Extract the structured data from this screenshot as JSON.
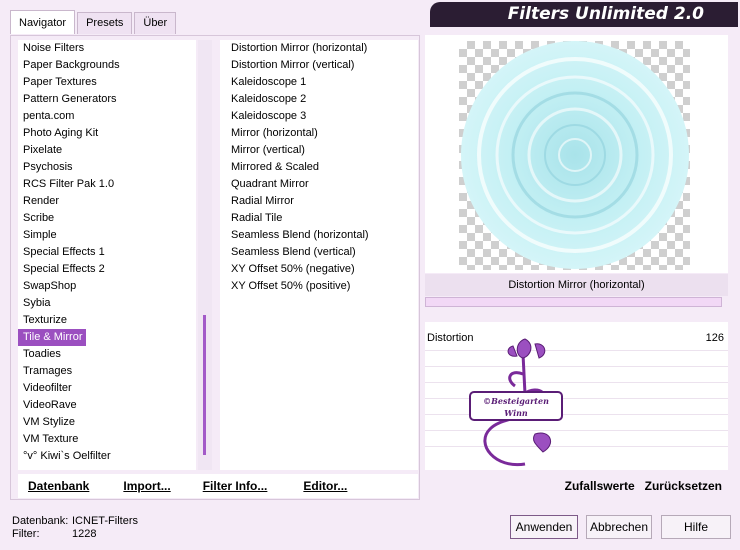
{
  "header": {
    "title": "Filters Unlimited 2.0"
  },
  "tabs": [
    {
      "label": "Navigator"
    },
    {
      "label": "Presets"
    },
    {
      "label": "Über"
    }
  ],
  "categories": [
    "Noise Filters",
    "Paper Backgrounds",
    "Paper Textures",
    "Pattern Generators",
    "penta.com",
    "Photo Aging Kit",
    "Pixelate",
    "Psychosis",
    "RCS Filter Pak 1.0",
    "Render",
    "Scribe",
    "Simple",
    "Special Effects 1",
    "Special Effects 2",
    "SwapShop",
    "Sybia",
    "Texturize",
    "Tile & Mirror",
    "Toadies",
    "Tramages",
    "Videofilter",
    "VideoRave",
    "VM Stylize",
    "VM Texture",
    "°v° Kiwi`s Oelfilter"
  ],
  "selected_category": "Tile & Mirror",
  "filters": [
    "Distortion Mirror (horizontal)",
    "Distortion Mirror (vertical)",
    "Kaleidoscope 1",
    "Kaleidoscope 2",
    "Kaleidoscope 3",
    "Mirror (horizontal)",
    "Mirror (vertical)",
    "Mirrored & Scaled",
    "Quadrant Mirror",
    "Radial Mirror",
    "Radial Tile",
    "Seamless Blend (horizontal)",
    "Seamless Blend (vertical)",
    "XY Offset 50% (negative)",
    "XY Offset 50% (positive)"
  ],
  "selected_filter": "Distortion Mirror (horizontal)",
  "param": {
    "label": "Distortion",
    "value": "126"
  },
  "watermark": {
    "line1": "©Besteigarten",
    "line2": "Winn"
  },
  "left_buttons": {
    "database": "Datenbank",
    "import": "Import...",
    "filter_info": "Filter Info...",
    "editor": "Editor..."
  },
  "right_buttons": {
    "randomize": "Zufallswerte",
    "reset": "Zurücksetzen"
  },
  "status": {
    "database_label": "Datenbank:",
    "database_value": "ICNET-Filters",
    "filter_label": "Filter:",
    "filter_value": "1228"
  },
  "dialog_buttons": {
    "apply": "Anwenden",
    "cancel": "Abbrechen",
    "help": "Hilfe"
  },
  "colors": {
    "accent": "#9b4fc0",
    "banner": "#2b1d33",
    "preview_circle": "#c7eff4"
  }
}
